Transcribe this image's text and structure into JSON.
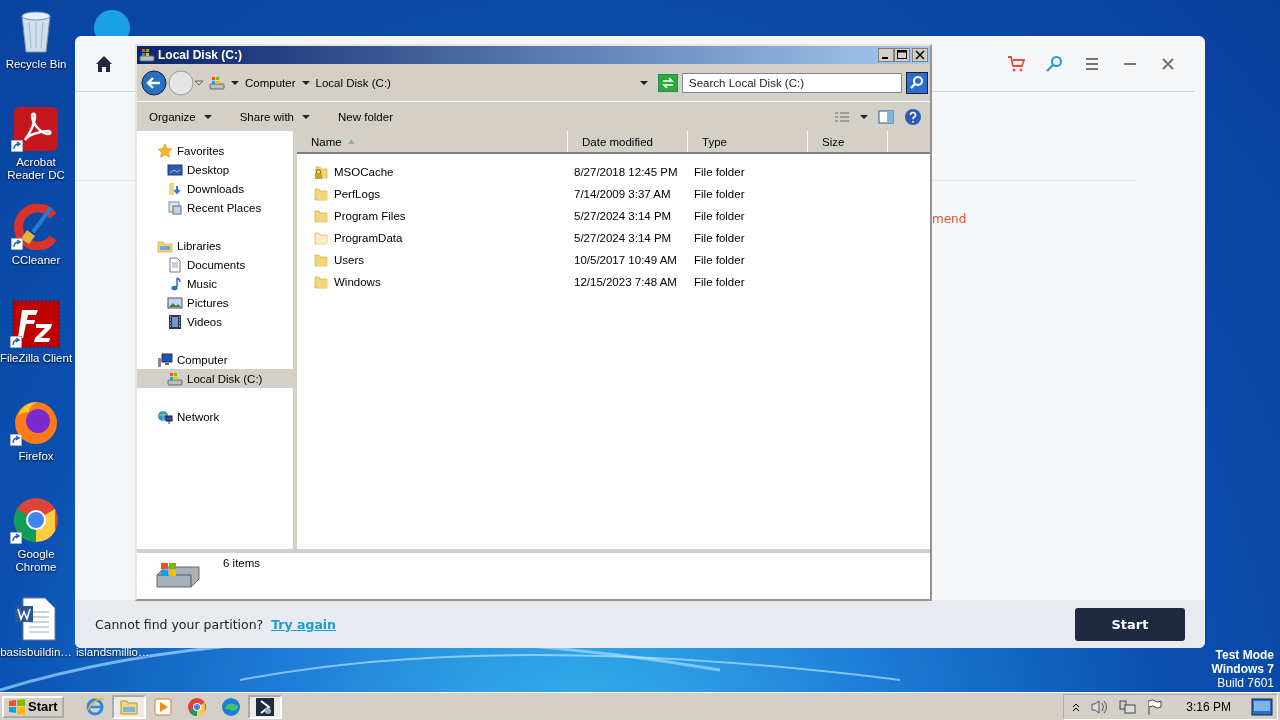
{
  "desktop_icons": [
    {
      "label": "Recycle Bin",
      "kind": "recycle",
      "shortcut": false
    },
    {
      "label": "Acrobat Reader DC",
      "kind": "pdf",
      "shortcut": true
    },
    {
      "label": "CCleaner",
      "kind": "cleaner",
      "shortcut": true
    },
    {
      "label": "FileZilla Client",
      "kind": "ftp",
      "shortcut": true
    },
    {
      "label": "Firefox",
      "kind": "fox",
      "shortcut": true
    },
    {
      "label": "Google Chrome",
      "kind": "chrome",
      "shortcut": true
    },
    {
      "label": "basisbuildin…",
      "kind": "doc",
      "shortcut": false
    }
  ],
  "desktop_labels": [
    {
      "label": "islandsmillio…"
    }
  ],
  "app_window": {
    "note": "mend",
    "footer_text": "Cannot find your partition?",
    "footer_link": "Try again",
    "start_button": "Start"
  },
  "explorer": {
    "title": "Local Disk (C:)",
    "breadcrumb": [
      "Computer",
      "Local Disk (C:)"
    ],
    "search": {
      "placeholder": "Search Local Disk (C:)"
    },
    "toolbar": [
      {
        "label": "Organize",
        "dropdown": true
      },
      {
        "label": "Share with",
        "dropdown": true
      },
      {
        "label": "New folder",
        "dropdown": false
      }
    ],
    "nav": [
      {
        "label": "Favorites",
        "kind": "star",
        "selected": false,
        "children": [
          {
            "label": "Desktop",
            "kind": "desktop",
            "selected": false
          },
          {
            "label": "Downloads",
            "kind": "downloads",
            "selected": false
          },
          {
            "label": "Recent Places",
            "kind": "recent",
            "selected": false
          }
        ]
      },
      {
        "label": "Libraries",
        "kind": "libraries",
        "selected": false,
        "children": [
          {
            "label": "Documents",
            "kind": "documents",
            "selected": false
          },
          {
            "label": "Music",
            "kind": "music",
            "selected": false
          },
          {
            "label": "Pictures",
            "kind": "pictures",
            "selected": false
          },
          {
            "label": "Videos",
            "kind": "videos",
            "selected": false
          }
        ]
      },
      {
        "label": "Computer",
        "kind": "computer",
        "selected": false,
        "children": [
          {
            "label": "Local Disk (C:)",
            "kind": "disk",
            "selected": true
          }
        ]
      },
      {
        "label": "Network",
        "kind": "network",
        "selected": false
      }
    ],
    "columns": [
      {
        "label": "Name",
        "sorted": true
      },
      {
        "label": "Date modified",
        "sorted": false
      },
      {
        "label": "Type",
        "sorted": false
      },
      {
        "label": "Size",
        "sorted": false
      }
    ],
    "files": [
      {
        "name": "MSOCache",
        "date": "8/27/2018 12:45 PM",
        "type": "File folder",
        "kind": "locked"
      },
      {
        "name": "PerfLogs",
        "date": "7/14/2009 3:37 AM",
        "type": "File folder",
        "kind": "folder"
      },
      {
        "name": "Program Files",
        "date": "5/27/2024 3:14 PM",
        "type": "File folder",
        "kind": "folder"
      },
      {
        "name": "ProgramData",
        "date": "5/27/2024 3:14 PM",
        "type": "File folder",
        "kind": "hidden"
      },
      {
        "name": "Users",
        "date": "10/5/2017 10:49 AM",
        "type": "File folder",
        "kind": "folder"
      },
      {
        "name": "Windows",
        "date": "12/15/2023 7:48 AM",
        "type": "File folder",
        "kind": "folder"
      }
    ],
    "status": "6 items"
  },
  "taskbar": {
    "start": "Start",
    "apps": [
      {
        "kind": "ie",
        "active": false
      },
      {
        "kind": "explorer",
        "active": true
      },
      {
        "kind": "media",
        "active": false
      },
      {
        "kind": "chrome",
        "active": false
      },
      {
        "kind": "edge",
        "active": false
      },
      {
        "kind": "tool",
        "active": true
      }
    ],
    "clock": "3:16 PM"
  },
  "system_notice": [
    "Test Mode",
    "Windows 7",
    "Build 7601"
  ]
}
